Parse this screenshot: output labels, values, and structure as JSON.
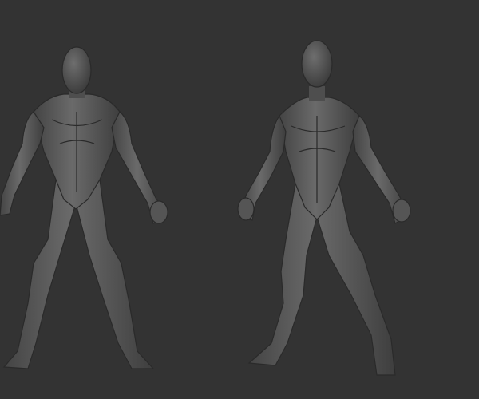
{
  "scene": {
    "background_color": "#333333",
    "figure_color": "#5c5c5c",
    "figure_shadow_color": "#2a2a2a",
    "figures": [
      {
        "name": "left-figure"
      },
      {
        "name": "right-figure"
      }
    ]
  }
}
